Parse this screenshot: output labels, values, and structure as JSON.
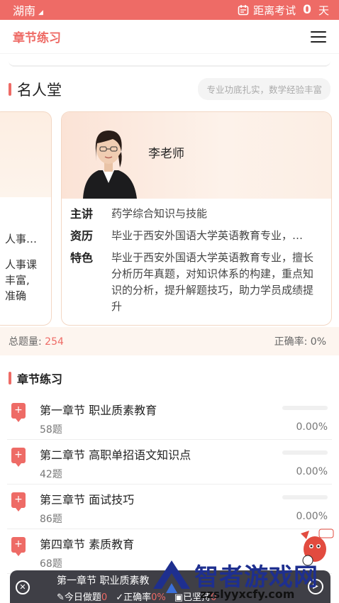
{
  "status": {
    "region": "湖南",
    "exam_prefix": "距离考试",
    "days": "0",
    "days_unit": "天"
  },
  "header": {
    "title": "章节练习"
  },
  "fame": {
    "title": "名人堂",
    "slogan": "专业功底扎实，数学经验丰富",
    "left_card_lines": [
      "人事…",
      "人事课",
      "丰富,",
      "准确"
    ],
    "teacher": {
      "name": "李老师",
      "rows": [
        {
          "key": "主讲",
          "value": "药学综合知识与技能"
        },
        {
          "key": "资历",
          "value": "毕业于西安外国语大学英语教育专业，…"
        },
        {
          "key": "特色",
          "value": "毕业于西安外国语大学英语教育专业，擅长分析历年真题，对知识体系的构建，重点知识的分析，提升解题技巧，助力学员成绩提升"
        }
      ]
    }
  },
  "stats": {
    "total_label": "总题量:",
    "total": "254",
    "accuracy_label": "正确率:",
    "accuracy": "0%"
  },
  "section": {
    "title": "章节练习"
  },
  "chapters": [
    {
      "name": "第一章节 职业质素教育",
      "count": "58题",
      "percent": "0.00%",
      "progress": 0
    },
    {
      "name": "第二章节 高职单招语文知识点",
      "count": "42题",
      "percent": "0.00%",
      "progress": 0
    },
    {
      "name": "第三章节 面试技巧",
      "count": "86题",
      "percent": "0.00%",
      "progress": 0
    },
    {
      "name": "第四章节 素质教育",
      "count": "68题",
      "percent": "",
      "progress": 0
    }
  ],
  "bottom_bar": {
    "title": "第一章节 职业质素教",
    "today_label": "今日做题",
    "today": "0",
    "acc_label": "正确率",
    "acc": "0%",
    "keep_label": "已坚持",
    "keep": "0"
  },
  "watermark": {
    "brand": "智者游戏网",
    "url": "zzslyyxcfy.com"
  },
  "colors": {
    "accent": "#ee6b66",
    "dark_bar": "#3f3f46",
    "brand_blue": "#1e2f8f"
  }
}
